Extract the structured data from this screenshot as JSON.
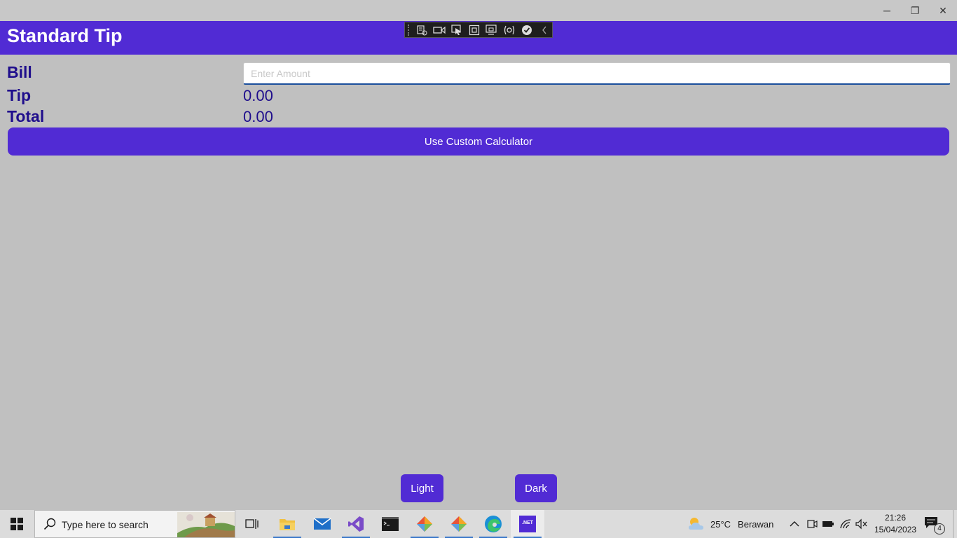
{
  "window": {
    "minimize_glyph": "─",
    "restore_glyph": "❐",
    "close_glyph": "✕"
  },
  "page": {
    "title": "Standard Tip"
  },
  "form": {
    "bill_label": "Bill",
    "bill_placeholder": "Enter Amount",
    "bill_value": "",
    "tip_label": "Tip",
    "tip_value": "0.00",
    "total_label": "Total",
    "total_value": "0.00"
  },
  "buttons": {
    "custom_calculator": "Use Custom Calculator",
    "light": "Light",
    "dark": "Dark"
  },
  "debug_toolbar": {
    "icons": [
      "live-visual-tree-icon",
      "record-icon",
      "select-element-icon",
      "display-layout-adorners-icon",
      "track-focus-icon",
      "binding-failures-icon",
      "hot-reload-status-icon",
      "collapse-icon"
    ]
  },
  "taskbar": {
    "search_placeholder": "Type here to search",
    "apps": [
      "task-view",
      "file-explorer",
      "mail",
      "visual-studio",
      "terminal",
      "git-app-1",
      "git-app-2",
      "edge",
      "dotnet-app"
    ],
    "dotnet_label": ".NET",
    "weather_temp": "25°C",
    "weather_desc": "Berawan",
    "time": "21:26",
    "date": "15/04/2023",
    "notification_count": "4"
  },
  "colors": {
    "accent": "#512bd4",
    "label_text": "#1f0e8c",
    "background": "#c0c0c0"
  }
}
